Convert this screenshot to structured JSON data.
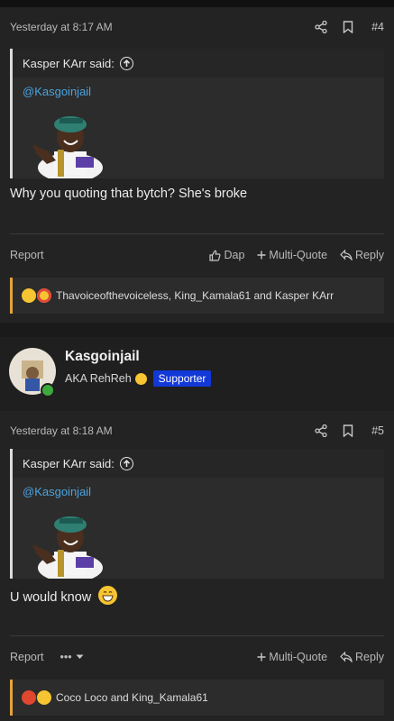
{
  "post1": {
    "date": "Yesterday at 8:17 AM",
    "number": "#4",
    "quote": {
      "author": "Kasper KArr said:",
      "mention": "@Kasgoinjail"
    },
    "message": "Why you quoting that bytch? She's broke",
    "actions": {
      "report": "Report",
      "dap": "Dap",
      "multi_quote": "Multi-Quote",
      "reply": "Reply"
    },
    "reactions": {
      "icons": [
        "rofl-emoji",
        "star-struck-emoji"
      ],
      "text": "Thavoiceofthevoiceless, King_Kamala61 and Kasper KArr"
    }
  },
  "author2": {
    "name": "Kasgoinjail",
    "title": "AKA RehReh",
    "badge": "Supporter",
    "colors": {
      "badge_bg": "#1238d8",
      "online": "#3eaa3e"
    }
  },
  "post2": {
    "date": "Yesterday at 8:18 AM",
    "number": "#5",
    "quote": {
      "author": "Kasper KArr said:",
      "mention": "@Kasgoinjail"
    },
    "message": "U would know",
    "actions": {
      "report": "Report",
      "more": "•••",
      "multi_quote": "Multi-Quote",
      "reply": "Reply"
    },
    "reactions": {
      "icons": [
        "angry-emoji",
        "rofl-emoji"
      ],
      "text": "Coco Loco and King_Kamala61"
    }
  }
}
